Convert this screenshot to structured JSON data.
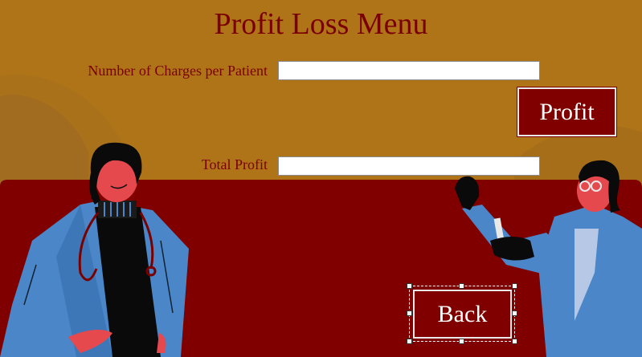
{
  "title": "Profit Loss Menu",
  "form": {
    "charges_label": "Number of Charges per Patient",
    "charges_value": "",
    "profit_label": "Total Profit",
    "profit_value": ""
  },
  "buttons": {
    "profit": "Profit",
    "back": "Back"
  },
  "colors": {
    "background_top": "#b07418",
    "background_bottom": "#800000",
    "accent": "#7a0000"
  },
  "illustrations": [
    "doctor-woman-illustration",
    "scientist-woman-illustration"
  ]
}
